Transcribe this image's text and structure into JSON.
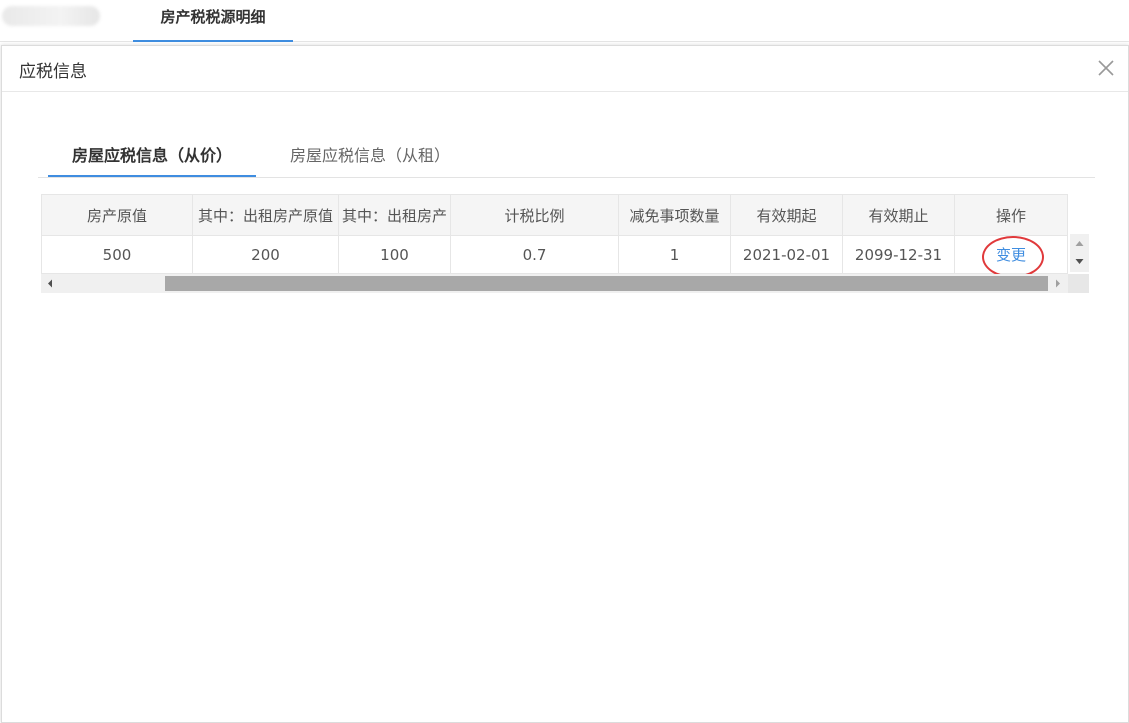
{
  "top_bar": {
    "active_tab": "房产税税源明细"
  },
  "modal": {
    "title": "应税信息",
    "tabs": [
      {
        "label": "房屋应税信息（从价）",
        "active": true
      },
      {
        "label": "房屋应税信息（从租）",
        "active": false
      }
    ],
    "table": {
      "headers": [
        "房产原值",
        "其中：出租房产原值",
        "其中：出租房产",
        "计税比例",
        "减免事项数量",
        "有效期起",
        "有效期止",
        "操作"
      ],
      "rows": [
        {
          "cells": [
            "500",
            "200",
            "100",
            "0.7",
            "1",
            "2021-02-01",
            "2099-12-31"
          ],
          "action_label": "变更"
        }
      ]
    }
  },
  "colors": {
    "accent": "#3f8de0",
    "highlight_circle": "#e0393b",
    "header_bg": "#f5f5f5"
  }
}
